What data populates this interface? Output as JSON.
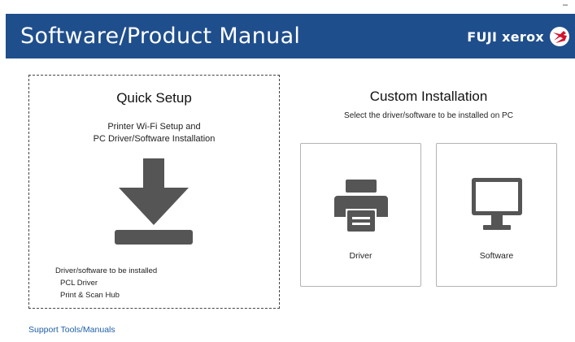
{
  "window": {
    "minimize_label": "–"
  },
  "header": {
    "title": "Software/Product Manual",
    "brand": "FUJI xerox",
    "background": "#1f4e8c"
  },
  "quick_setup": {
    "title": "Quick Setup",
    "description_line1": "Printer Wi-Fi Setup and",
    "description_line2": "PC Driver/Software Installation",
    "icon": "download-icon",
    "list_heading": "Driver/software to be installed",
    "items": [
      "PCL Driver",
      "Print & Scan Hub"
    ]
  },
  "custom_installation": {
    "title": "Custom Installation",
    "subtitle": "Select the driver/software to be installed on PC",
    "tiles": [
      {
        "label": "Driver",
        "icon": "printer-icon"
      },
      {
        "label": "Software",
        "icon": "monitor-icon"
      }
    ]
  },
  "support": {
    "link_label": "Support Tools/Manuals",
    "color": "#1f5fa8"
  }
}
